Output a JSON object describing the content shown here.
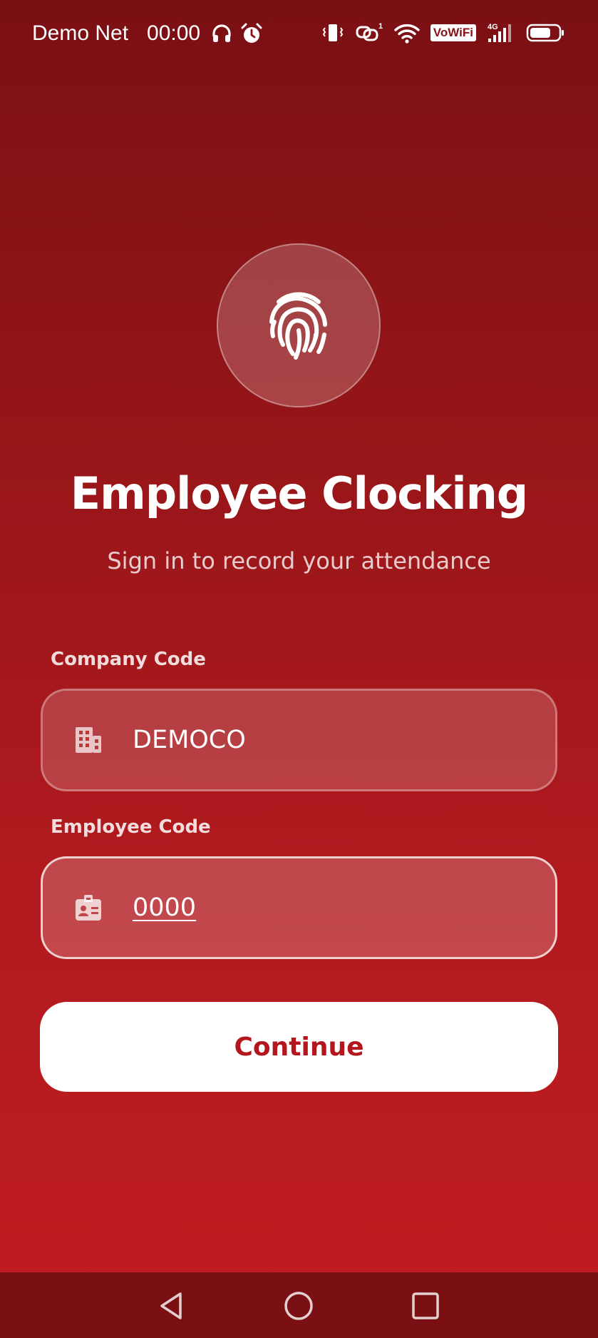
{
  "status_bar": {
    "carrier": "Demo Net",
    "time": "00:00",
    "left_icons": [
      "headphones-icon",
      "alarm-icon"
    ],
    "right_icons": [
      "vibrate-icon",
      "hotspot-icon",
      "wifi-icon",
      "vowifi-badge",
      "signal-4g-icon",
      "battery-icon"
    ],
    "vowifi_label": "VoWiFi",
    "network_label": "4G"
  },
  "header": {
    "icon": "fingerprint-icon",
    "title": "Employee Clocking",
    "subtitle": "Sign in to record your attendance"
  },
  "form": {
    "company": {
      "label": "Company Code",
      "value": "DEMOCO",
      "icon": "building-icon"
    },
    "employee": {
      "label": "Employee Code",
      "value": "0000",
      "icon": "id-badge-icon"
    },
    "submit_label": "Continue"
  },
  "nav_bar": {
    "items": [
      "back-icon",
      "home-icon",
      "recents-icon"
    ]
  },
  "colors": {
    "background_top": "#7a1014",
    "background_bottom": "#c11d22",
    "button_text": "#b3171d",
    "nav_bar": "#7b1014"
  }
}
